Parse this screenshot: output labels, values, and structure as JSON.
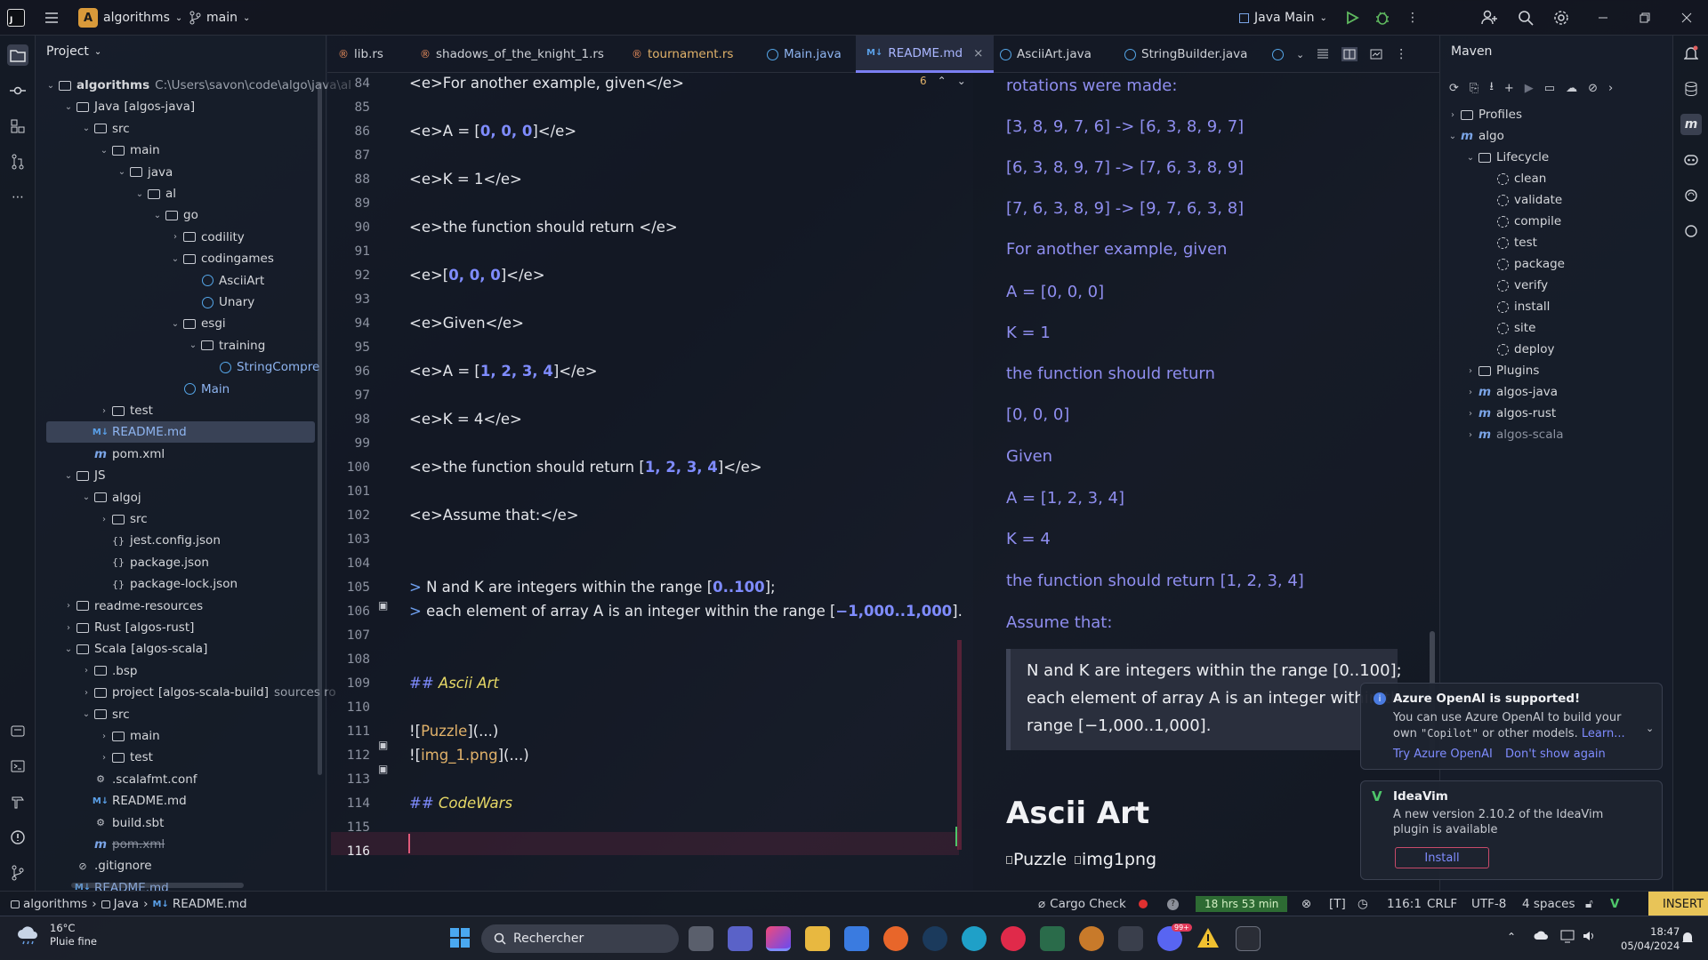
{
  "titlebar": {
    "app": "J",
    "project_badge": "A",
    "project": "algorithms",
    "branch": "main",
    "run_config": "Java Main"
  },
  "project_panel": {
    "title": "Project"
  },
  "tree": [
    {
      "label": "algorithms",
      "ext": "C:\\Users\\savon\\code\\algo\\java\\al",
      "lvl": 0,
      "chev": "v",
      "icon": "folder",
      "bold": true
    },
    {
      "label": "Java",
      "ext2": "[algos-java]",
      "lvl": 1,
      "chev": "v",
      "icon": "folder"
    },
    {
      "label": "src",
      "lvl": 2,
      "chev": "v",
      "icon": "folder"
    },
    {
      "label": "main",
      "lvl": 3,
      "chev": "v",
      "icon": "folder"
    },
    {
      "label": "java",
      "lvl": 4,
      "chev": "v",
      "icon": "folder"
    },
    {
      "label": "al",
      "lvl": 5,
      "chev": "v",
      "icon": "folder"
    },
    {
      "label": "go",
      "lvl": 6,
      "chev": "v",
      "icon": "folder"
    },
    {
      "label": "codility",
      "lvl": 7,
      "chev": ">",
      "icon": "folder"
    },
    {
      "label": "codingames",
      "lvl": 7,
      "chev": "v",
      "icon": "folder"
    },
    {
      "label": "AsciiArt",
      "lvl": 8,
      "chev": "",
      "icon": "class"
    },
    {
      "label": "Unary",
      "lvl": 8,
      "chev": "",
      "icon": "class"
    },
    {
      "label": "esgi",
      "lvl": 7,
      "chev": "v",
      "icon": "folder"
    },
    {
      "label": "training",
      "lvl": 8,
      "chev": "v",
      "icon": "folder"
    },
    {
      "label": "StringCompre",
      "lvl": 9,
      "chev": "",
      "icon": "class",
      "blue": true
    },
    {
      "label": "Main",
      "lvl": 7,
      "chev": "",
      "icon": "class",
      "blue": true
    },
    {
      "label": "test",
      "lvl": 3,
      "chev": ">",
      "icon": "folder"
    },
    {
      "label": "README.md",
      "lvl": 2,
      "chev": "",
      "icon": "md",
      "sel": true,
      "blue": true
    },
    {
      "label": "pom.xml",
      "lvl": 2,
      "chev": "",
      "icon": "m"
    },
    {
      "label": "JS",
      "lvl": 1,
      "chev": "v",
      "icon": "folder"
    },
    {
      "label": "algoj",
      "lvl": 2,
      "chev": "v",
      "icon": "folder"
    },
    {
      "label": "src",
      "lvl": 3,
      "chev": ">",
      "icon": "folder"
    },
    {
      "label": "jest.config.json",
      "lvl": 3,
      "chev": "",
      "icon": "json"
    },
    {
      "label": "package.json",
      "lvl": 3,
      "chev": "",
      "icon": "json"
    },
    {
      "label": "package-lock.json",
      "lvl": 3,
      "chev": "",
      "icon": "json"
    },
    {
      "label": "readme-resources",
      "lvl": 1,
      "chev": ">",
      "icon": "folder"
    },
    {
      "label": "Rust",
      "ext2": "[algos-rust]",
      "lvl": 1,
      "chev": ">",
      "icon": "folder"
    },
    {
      "label": "Scala",
      "ext2": "[algos-scala]",
      "lvl": 1,
      "chev": "v",
      "icon": "folder"
    },
    {
      "label": ".bsp",
      "lvl": 2,
      "chev": ">",
      "icon": "folder"
    },
    {
      "label": "project",
      "ext2": "[algos-scala-build]",
      "ext": "sources ro",
      "lvl": 2,
      "chev": ">",
      "icon": "folder"
    },
    {
      "label": "src",
      "lvl": 2,
      "chev": "v",
      "icon": "folder"
    },
    {
      "label": "main",
      "lvl": 3,
      "chev": ">",
      "icon": "folder"
    },
    {
      "label": "test",
      "lvl": 3,
      "chev": ">",
      "icon": "folder"
    },
    {
      "label": ".scalafmt.conf",
      "lvl": 2,
      "chev": "",
      "icon": "conf"
    },
    {
      "label": "README.md",
      "lvl": 2,
      "chev": "",
      "icon": "md"
    },
    {
      "label": "build.sbt",
      "lvl": 2,
      "chev": "",
      "icon": "conf"
    },
    {
      "label": "pom.xml",
      "lvl": 2,
      "chev": "",
      "icon": "m",
      "strike": true
    },
    {
      "label": ".gitignore",
      "lvl": 1,
      "chev": "",
      "icon": "gitignore"
    },
    {
      "label": "README.md",
      "lvl": 1,
      "chev": "",
      "icon": "md",
      "blue": true
    }
  ],
  "tabs": [
    {
      "label": "lib.rs",
      "icon": "rs"
    },
    {
      "label": "shadows_of_the_knight_1.rs",
      "icon": "rs"
    },
    {
      "label": "tournament.rs",
      "icon": "rs",
      "orange": true
    },
    {
      "label": "Main.java",
      "icon": "java",
      "blue": true
    },
    {
      "label": "README.md",
      "icon": "md",
      "active": true,
      "close": "×"
    },
    {
      "label": "AsciiArt.java",
      "icon": "java"
    },
    {
      "label": "StringBuilder.java",
      "icon": "java"
    }
  ],
  "editor": {
    "problems_count": "6",
    "lines": [
      {
        "n": "84",
        "html": [
          [
            "t",
            "<e>For another example, given</e>"
          ]
        ]
      },
      {
        "n": "85",
        "html": []
      },
      {
        "n": "86",
        "html": [
          [
            "t",
            "<e>A = ["
          ],
          [
            "num",
            "0, 0, 0"
          ],
          [
            "t",
            "]</e>"
          ]
        ]
      },
      {
        "n": "87",
        "html": []
      },
      {
        "n": "88",
        "html": [
          [
            "t",
            "<e>K = 1</e>"
          ]
        ]
      },
      {
        "n": "89",
        "html": []
      },
      {
        "n": "90",
        "html": [
          [
            "t",
            "<e>the function should return </e>"
          ]
        ]
      },
      {
        "n": "91",
        "html": []
      },
      {
        "n": "92",
        "html": [
          [
            "t",
            "<e>["
          ],
          [
            "num",
            "0, 0, 0"
          ],
          [
            "t",
            "]</e>"
          ]
        ]
      },
      {
        "n": "93",
        "html": []
      },
      {
        "n": "94",
        "html": [
          [
            "t",
            "<e>Given</e>"
          ]
        ]
      },
      {
        "n": "95",
        "html": []
      },
      {
        "n": "96",
        "html": [
          [
            "t",
            "<e>A = ["
          ],
          [
            "num",
            "1, 2, 3, 4"
          ],
          [
            "t",
            "]</e>"
          ]
        ]
      },
      {
        "n": "97",
        "html": []
      },
      {
        "n": "98",
        "html": [
          [
            "t",
            "<e>K = 4</e>"
          ]
        ]
      },
      {
        "n": "99",
        "html": []
      },
      {
        "n": "100",
        "html": [
          [
            "t",
            "<e>the function should return ["
          ],
          [
            "num",
            "1, 2, 3, 4"
          ],
          [
            "t",
            "]</e>"
          ]
        ]
      },
      {
        "n": "101",
        "html": []
      },
      {
        "n": "102",
        "html": [
          [
            "t",
            "<e>Assume that:</e>"
          ]
        ]
      },
      {
        "n": "103",
        "html": []
      },
      {
        "n": "104",
        "html": []
      },
      {
        "n": "105",
        "html": [
          [
            "quote",
            "> "
          ],
          [
            "t",
            "N and K are integers within the range "
          ],
          [
            "t",
            "["
          ],
          [
            "num",
            "0..100"
          ],
          [
            "t",
            "];"
          ]
        ]
      },
      {
        "n": "106",
        "html": [
          [
            "quote",
            "> "
          ],
          [
            "t",
            "each element of array A is an integer within the range "
          ],
          [
            "t",
            "["
          ],
          [
            "num",
            "−1,000..1,000"
          ],
          [
            "t",
            "]."
          ]
        ]
      },
      {
        "n": "107",
        "html": []
      },
      {
        "n": "108",
        "html": []
      },
      {
        "n": "109",
        "html": [
          [
            "hash",
            "## "
          ],
          [
            "head",
            "Ascii Art"
          ]
        ]
      },
      {
        "n": "110",
        "html": []
      },
      {
        "n": "111",
        "html": [
          [
            "t",
            "!["
          ],
          [
            "link",
            "Puzzle"
          ],
          [
            "t",
            "](...)"
          ]
        ]
      },
      {
        "n": "112",
        "html": [
          [
            "t",
            "!["
          ],
          [
            "link",
            "img_1.png"
          ],
          [
            "t",
            "](...)"
          ]
        ]
      },
      {
        "n": "113",
        "html": []
      },
      {
        "n": "114",
        "html": [
          [
            "hash",
            "## "
          ],
          [
            "head",
            "CodeWars"
          ]
        ]
      },
      {
        "n": "115",
        "html": []
      },
      {
        "n": "116",
        "html": []
      }
    ]
  },
  "preview": {
    "lines": [
      "rotations were made:",
      "[3, 8, 9, 7, 6] -> [6, 3, 8, 9, 7]",
      "[6, 3, 8, 9, 7] -> [7, 6, 3, 8, 9]",
      "[7, 6, 3, 8, 9] -> [9, 7, 6, 3, 8]",
      "For another example, given",
      "A = [0, 0, 0]",
      "K = 1",
      "the function should return",
      "[0, 0, 0]",
      "Given",
      "A = [1, 2, 3, 4]",
      "K = 4",
      "the function should return [1, 2, 3, 4]",
      "Assume that:"
    ],
    "quote": [
      "N and K are integers within the range [0..100];",
      "each element of array A is an integer within th",
      "range [−1,000..1,000]."
    ],
    "heading": "Ascii Art",
    "img1": "Puzzle",
    "img2": "img1png"
  },
  "maven": {
    "title": "Maven",
    "items": [
      {
        "label": "Profiles",
        "lvl": 0,
        "chev": ">",
        "icon": "folder"
      },
      {
        "label": "algo",
        "lvl": 0,
        "chev": "v",
        "icon": "m"
      },
      {
        "label": "Lifecycle",
        "lvl": 1,
        "chev": "v",
        "icon": "folder"
      },
      {
        "label": "clean",
        "lvl": 2,
        "icon": "gear"
      },
      {
        "label": "validate",
        "lvl": 2,
        "icon": "gear"
      },
      {
        "label": "compile",
        "lvl": 2,
        "icon": "gear"
      },
      {
        "label": "test",
        "lvl": 2,
        "icon": "gear"
      },
      {
        "label": "package",
        "lvl": 2,
        "icon": "gear"
      },
      {
        "label": "verify",
        "lvl": 2,
        "icon": "gear"
      },
      {
        "label": "install",
        "lvl": 2,
        "icon": "gear"
      },
      {
        "label": "site",
        "lvl": 2,
        "icon": "gear"
      },
      {
        "label": "deploy",
        "lvl": 2,
        "icon": "gear"
      },
      {
        "label": "Plugins",
        "lvl": 1,
        "chev": ">",
        "icon": "folder"
      },
      {
        "label": "algos-java",
        "lvl": 1,
        "chev": ">",
        "icon": "m"
      },
      {
        "label": "algos-rust",
        "lvl": 1,
        "chev": ">",
        "icon": "m"
      },
      {
        "label": "algos-scala",
        "lvl": 1,
        "chev": ">",
        "icon": "m",
        "dim": true
      }
    ]
  },
  "notif1": {
    "title": "Azure OpenAI is supported!",
    "body1": "You can use Azure OpenAI to build your",
    "body2a": "own ",
    "body2b": "\"Copilot\"",
    "body2c": " or other models. ",
    "body2d": "Learn...",
    "link1": "Try Azure OpenAI",
    "link2": "Don't show again"
  },
  "notif2": {
    "title": "IdeaVim",
    "body1": "A new version 2.10.2 of the IdeaVim",
    "body2": "plugin is available",
    "button": "Install"
  },
  "status": {
    "bc1": "algorithms",
    "bc2": "Java",
    "bc3": "README.md",
    "cargo": "Cargo Check",
    "time": "18 hrs 53 min",
    "pos": "116:1",
    "eol": "CRLF",
    "enc": "UTF-8",
    "indent": "4 spaces",
    "mode": "INSERT"
  },
  "taskbar": {
    "temp": "16°C",
    "weather": "Pluie fine",
    "search": "Rechercher",
    "time": "18:47",
    "date": "05/04/2024",
    "badge": "99+"
  }
}
